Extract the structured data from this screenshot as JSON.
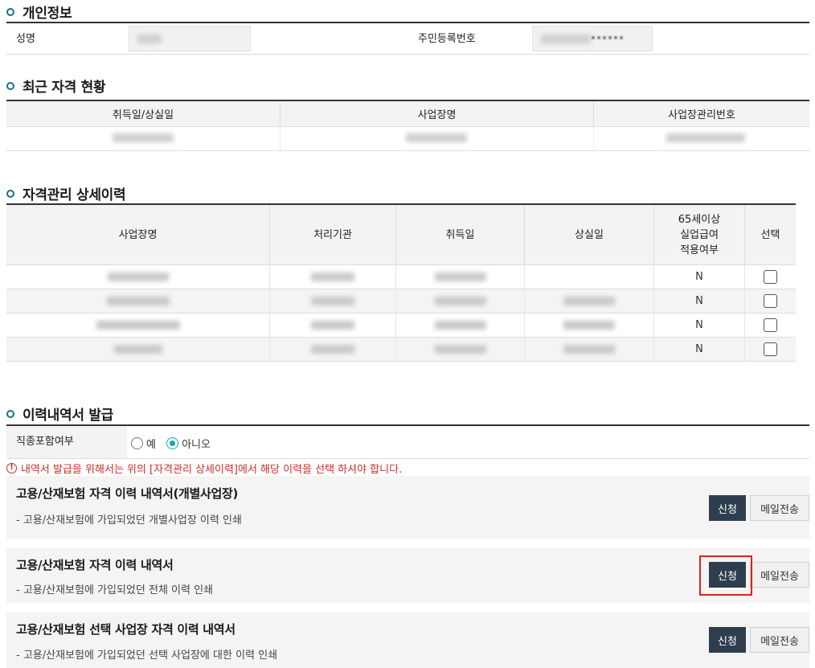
{
  "personal": {
    "title": "개인정보",
    "name_label": "성명",
    "rrn_label": "주민등록번호",
    "rrn_mask": "******"
  },
  "recent": {
    "title": "최근 자격 현황",
    "headers": [
      "취득일/상실일",
      "사업장명",
      "사업장관리번호"
    ]
  },
  "history": {
    "title": "자격관리 상세이력",
    "headers": [
      "사업장명",
      "처리기관",
      "취득일",
      "상실일",
      "65세이상\n실업급여\n적용여부",
      "선택"
    ],
    "rows": [
      {
        "flag": "N"
      },
      {
        "flag": "N"
      },
      {
        "flag": "N"
      },
      {
        "flag": "N"
      }
    ]
  },
  "issue": {
    "title": "이력내역서 발급",
    "job_label": "직종포함여부",
    "opt_yes": "예",
    "opt_no": "아니오",
    "notice": "내역서 발급을 위해서는 위의 [자격관리 상세이력]에서 해당 이력을 선택 하셔야 합니다.",
    "cards": [
      {
        "title": "고용/산재보험 자격 이력 내역서(개별사업장)",
        "desc": "- 고용/산재보험에 가입되었던 개별사업장 이력 인쇄",
        "apply": "신청",
        "mail": "메일전송"
      },
      {
        "title": "고용/산재보험 자격 이력 내역서",
        "desc": "- 고용/산재보험에 가입되었던 전체 이력 인쇄",
        "apply": "신청",
        "mail": "메일전송"
      },
      {
        "title": "고용/산재보험 선택 사업장 자격 이력 내역서",
        "desc": "- 고용/산재보험에 가입되었던 선택 사업장에 대한 이력 인쇄",
        "apply": "신청",
        "mail": "메일전송"
      }
    ]
  },
  "colors": {
    "accent": "#1b6f88",
    "button": "#2e3e4e",
    "warning": "#c8302a",
    "highlight": "#e02020"
  }
}
